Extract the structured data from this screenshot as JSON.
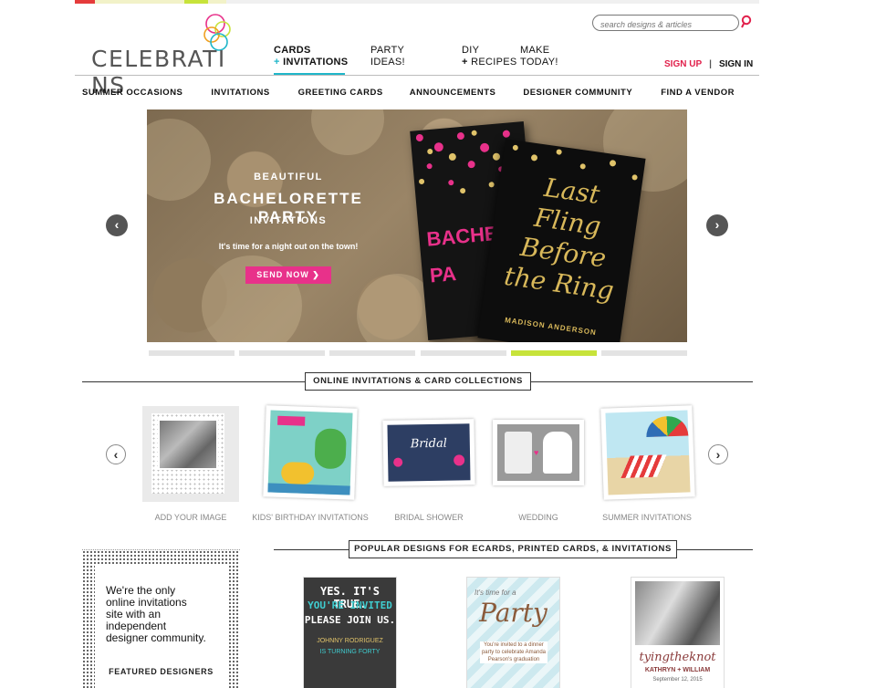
{
  "brand": {
    "logo_text": "CELEBRATI NS"
  },
  "search": {
    "placeholder": "search designs & articles"
  },
  "auth": {
    "signup": "SIGN UP",
    "separator": "|",
    "signin": "SIGN IN"
  },
  "nav_main": [
    {
      "line1": "CARDS",
      "plus": "+",
      "line2": "INVITATIONS"
    },
    {
      "line1": "PARTY",
      "line2": "IDEAS!"
    },
    {
      "line1": "DIY",
      "plus": "+",
      "line2": "RECIPES"
    },
    {
      "line1": "MAKE",
      "line2": "TODAY!"
    }
  ],
  "subnav": [
    "SUMMER OCCASIONS",
    "INVITATIONS",
    "GREETING CARDS",
    "ANNOUNCEMENTS",
    "DESIGNER COMMUNITY",
    "FIND A VENDOR"
  ],
  "hero": {
    "kicker": "BEAUTIFUL",
    "title": "BACHELORETTE PARTY",
    "subtitle": "INVITATIONS",
    "tagline": "It's time for a night out on the town!",
    "button": "SEND NOW ❯",
    "card_back_text": "BACHE PA",
    "card_front_script": "Last Fling Before the Ring",
    "card_front_name": "MADISON ANDERSON"
  },
  "carousel": {
    "slide_count": 6,
    "active_index": 4
  },
  "collections": {
    "heading": "ONLINE INVITATIONS & CARD COLLECTIONS",
    "items": [
      {
        "label": "ADD YOUR IMAGE"
      },
      {
        "label": "KIDS' BIRTHDAY INVITATIONS"
      },
      {
        "label": "BRIDAL SHOWER"
      },
      {
        "label": "WEDDING"
      },
      {
        "label": "SUMMER INVITATIONS"
      }
    ]
  },
  "popular": {
    "heading": "POPULAR DESIGNS FOR ECARDS, PRINTED CARDS, & INVITATIONS",
    "cards": [
      {
        "line1": "YES. IT'S TRUE.",
        "line2": "YOU'RE INVITED",
        "line3": "PLEASE JOIN US.",
        "name": "JOHNNY RODRIGUEZ",
        "detail": "IS TURNING FORTY"
      },
      {
        "script": "It's time for a",
        "big": "Party",
        "detail": "You're invited to a dinner party to celebrate Amanda Pearson's graduation"
      },
      {
        "script": "tyingtheknot",
        "names": "KATHRYN + WILLIAM",
        "date": "September 12, 2015"
      }
    ]
  },
  "featured": {
    "text_lines": [
      "We're the only",
      "online invitations",
      "site with an",
      "independent",
      "designer community."
    ],
    "label": "FEATURED DESIGNERS"
  },
  "colors": {
    "accent_teal": "#1fb6c9",
    "signup_red": "#e1204b",
    "send_pink": "#e8318a",
    "active_dot": "#c7e33a"
  }
}
